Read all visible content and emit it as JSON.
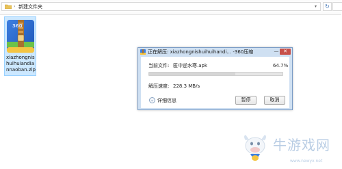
{
  "explorer": {
    "breadcrumb_text": "新建文件夹",
    "refresh_icon": "refresh-icon",
    "search_icon": "search-icon"
  },
  "file_item": {
    "name": "xiazhongnishuihuiandiannaoban.zip",
    "icon_label": "360"
  },
  "dialog": {
    "title": "正在解压: xiazhongnishuihuihandi... -360压缩",
    "minimize_glyph": "—",
    "close_glyph": "✕",
    "current_file_label": "当前文件:",
    "current_file": "匿中逆水寒.apk",
    "percent_text": "64.7%",
    "progress": 0.647,
    "speed_label": "解压速度:",
    "speed_value": "228.3 MB/s",
    "details_label": "详细信息",
    "pause_label": "暂停",
    "cancel_label": "取消"
  },
  "watermark": {
    "text": "牛游戏网",
    "url": "www.newyx.net"
  },
  "colors": {
    "accent": "#3a6fb2",
    "dialog_frame": "#cfe0f2",
    "selection": "#cce8ff",
    "close_button": "#c7504a"
  }
}
